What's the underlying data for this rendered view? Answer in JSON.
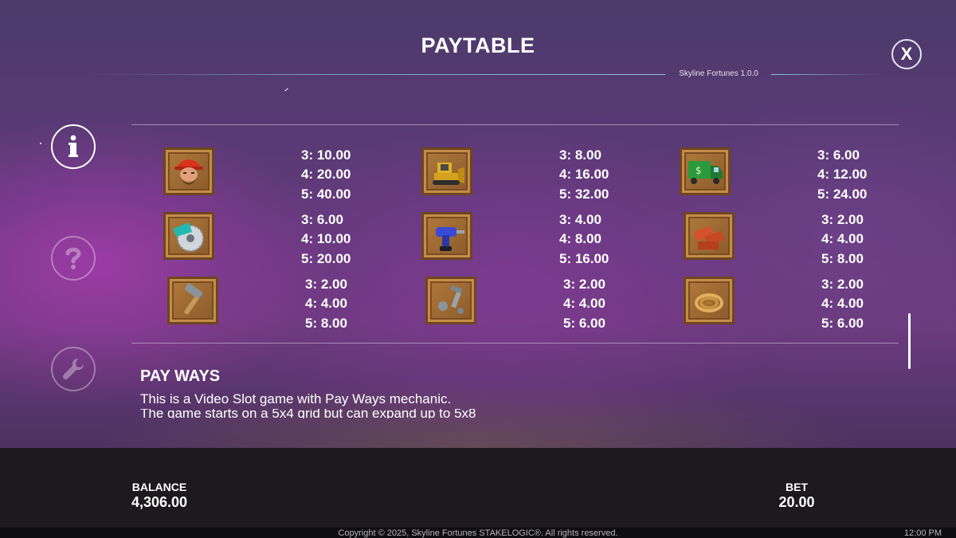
{
  "header": {
    "title": "PAYTABLE",
    "version": "Skyline Fortunes 1.0.0",
    "close_label": "X"
  },
  "sidebar": {
    "items": [
      {
        "name": "info",
        "icon": "info-icon",
        "active": true
      },
      {
        "name": "help",
        "icon": "question-icon",
        "active": false
      },
      {
        "name": "settings",
        "icon": "wrench-icon",
        "active": false
      }
    ]
  },
  "symbols": [
    {
      "icon": "builder-icon",
      "pays": [
        "3: 10.00",
        "4: 20.00",
        "5: 40.00"
      ]
    },
    {
      "icon": "bulldozer-icon",
      "pays": [
        "3: 8.00",
        "4: 16.00",
        "5: 32.00"
      ]
    },
    {
      "icon": "truck-icon",
      "pays": [
        "3: 6.00",
        "4: 12.00",
        "5: 24.00"
      ]
    },
    {
      "icon": "circular-saw-icon",
      "pays": [
        "3: 6.00",
        "4: 10.00",
        "5: 20.00"
      ]
    },
    {
      "icon": "drill-icon",
      "pays": [
        "3: 4.00",
        "4: 8.00",
        "5: 16.00"
      ]
    },
    {
      "icon": "bricks-icon",
      "pays": [
        "3: 2.00",
        "4: 4.00",
        "5: 8.00"
      ]
    },
    {
      "icon": "hammer-icon",
      "pays": [
        "3: 2.00",
        "4: 4.00",
        "5: 8.00"
      ]
    },
    {
      "icon": "bolts-icon",
      "pays": [
        "3: 2.00",
        "4: 4.00",
        "5: 6.00"
      ]
    },
    {
      "icon": "rope-icon",
      "pays": [
        "3: 2.00",
        "4: 4.00",
        "5: 6.00"
      ]
    }
  ],
  "pay_ways": {
    "title": "PAY WAYS",
    "line1": "This is a Video Slot game with Pay Ways mechanic.",
    "line2": "The game starts on a 5x4 grid but can expand up to 5x8"
  },
  "bottom_bar": {
    "balance_label": "BALANCE",
    "balance_value": "4,306.00",
    "bet_label": "BET",
    "bet_value": "20.00"
  },
  "footer": {
    "copyright": "Copyright © 2025, Skyline Fortunes STAKELOGIC®. All rights reserved.",
    "clock": "12:00 PM"
  },
  "colors": {
    "crate_wood": "#b07a3c",
    "text": "#ffffff",
    "bottom_bar": "#1c1a1f"
  }
}
